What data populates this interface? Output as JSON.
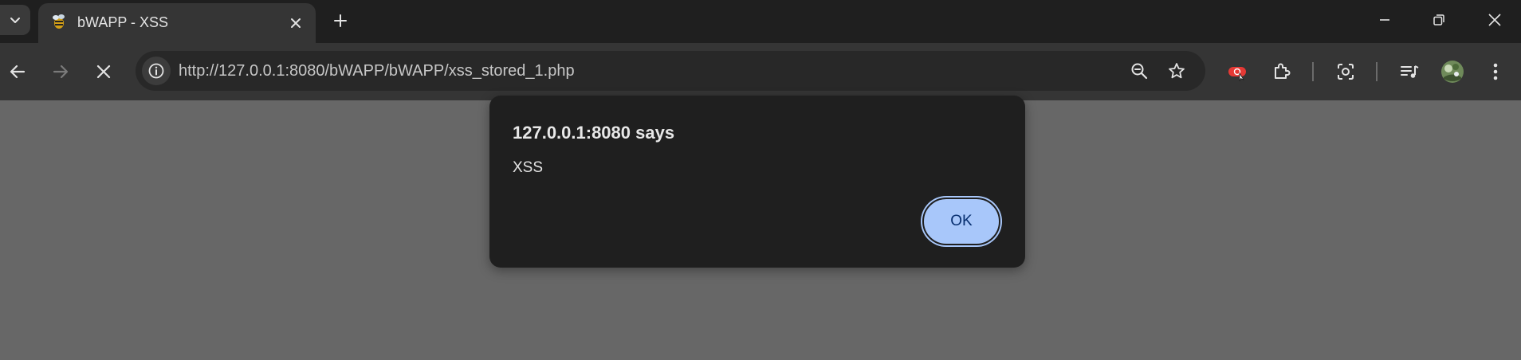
{
  "tab": {
    "title": "bWAPP - XSS"
  },
  "omnibox": {
    "url": "http://127.0.0.1:8080/bWAPP/bWAPP/xss_stored_1.php"
  },
  "dialog": {
    "title": "127.0.0.1:8080 says",
    "message": "XSS",
    "ok_label": "OK"
  },
  "colors": {
    "page_background": "#676767",
    "dialog_background": "#1f1f1f",
    "ok_button": "#a8c7fa",
    "ok_text": "#062e6f",
    "extension_badge": "#e53935"
  },
  "icons": {
    "tabstrip": [
      "chevron-down-icon",
      "favicon-icon",
      "close-icon",
      "plus-icon",
      "minimize-icon",
      "restore-icon",
      "close-window-icon"
    ],
    "toolbar": [
      "back-arrow-icon",
      "forward-arrow-icon",
      "stop-icon",
      "info-icon",
      "zoom-out-icon",
      "star-icon",
      "extension-badge-icon",
      "puzzle-icon",
      "screenshot-icon",
      "media-queue-icon",
      "avatar",
      "more-vert-icon"
    ]
  }
}
